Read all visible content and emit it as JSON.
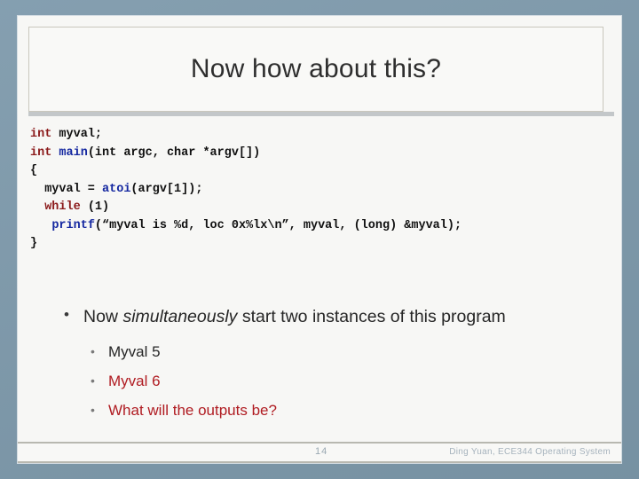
{
  "slide": {
    "title": "Now how about this?",
    "code_lines": [
      [
        {
          "t": "int",
          "c": "kw"
        },
        {
          "t": " myval;",
          "c": "plain"
        }
      ],
      [
        {
          "t": "int",
          "c": "kw"
        },
        {
          "t": " ",
          "c": "plain"
        },
        {
          "t": "main",
          "c": "fn"
        },
        {
          "t": "(int argc, char *argv[])",
          "c": "plain"
        }
      ],
      [
        {
          "t": "{",
          "c": "plain"
        }
      ],
      [
        {
          "t": "  myval = ",
          "c": "plain"
        },
        {
          "t": "atoi",
          "c": "fn"
        },
        {
          "t": "(argv[1]);",
          "c": "plain"
        }
      ],
      [
        {
          "t": "  ",
          "c": "plain"
        },
        {
          "t": "while",
          "c": "kw"
        },
        {
          "t": " (1)",
          "c": "plain"
        }
      ],
      [
        {
          "t": "   ",
          "c": "plain"
        },
        {
          "t": "printf",
          "c": "fn"
        },
        {
          "t": "(“myval is %d, loc 0x%lx\\n”, myval, (long) &myval);",
          "c": "plain"
        }
      ],
      [
        {
          "t": "}",
          "c": "plain"
        }
      ]
    ],
    "bullet_main_pre": "Now ",
    "bullet_main_em": "simultaneously",
    "bullet_main_post": " start two instances of this program",
    "sub_bullets": [
      {
        "label": "Myval 5",
        "color": "#262626",
        "is_red": false
      },
      {
        "label": "Myval 6",
        "color": "#b01c22",
        "is_red": true
      },
      {
        "label": "What will the outputs be?",
        "color": "#b01c22",
        "is_red": true
      }
    ],
    "footer": {
      "page_number": "14",
      "credit": "Ding Yuan, ECE344 Operating System"
    },
    "colors": {
      "mat": "#7d99ab",
      "card": "#f7f7f5",
      "keyword": "#8b1a1a",
      "function": "#1427a0",
      "accent_red": "#b01c22",
      "footer_text": "#a6b3bd"
    }
  }
}
